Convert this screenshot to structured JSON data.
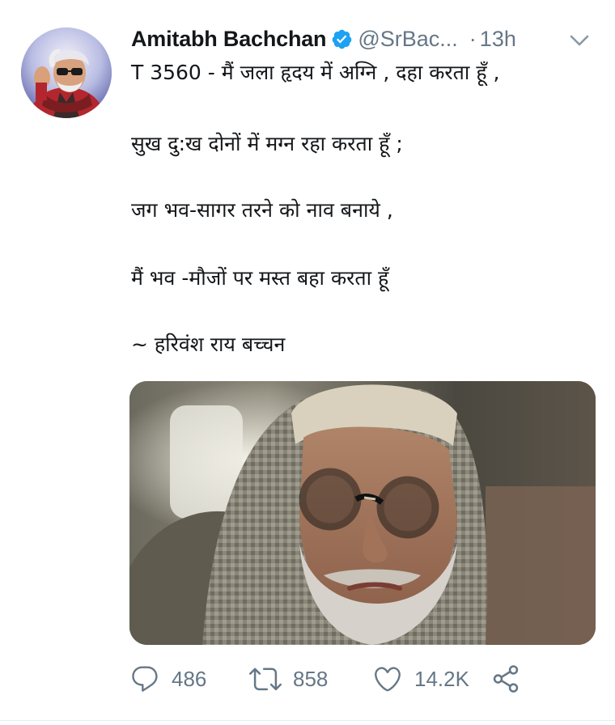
{
  "author": {
    "display_name": "Amitabh Bachchan",
    "handle": "@SrBac...",
    "verified": true,
    "time_separator": "·",
    "time": "13h",
    "avatar_icon": "user-avatar"
  },
  "tweet": {
    "lines": [
      "T 3560 - मैं  जला हृदय में अग्नि , दहा करता हूँ  ,",
      "सुख दु:ख दोनों में मग्न रहा करता हूँ  ;",
      "जग भव-सागर तरने को नाव बनाये  ,",
      "मैं भव -मौजों पर मस्त बहा करता हूँ",
      "~ हरिवंश राय बच्चन"
    ]
  },
  "actions": {
    "reply": {
      "icon": "reply-icon",
      "count": "486"
    },
    "retweet": {
      "icon": "retweet-icon",
      "count": "858"
    },
    "like": {
      "icon": "heart-icon",
      "count": "14.2K"
    },
    "share": {
      "icon": "share-icon"
    }
  },
  "colors": {
    "text": "#14171a",
    "secondary": "#657786",
    "verified": "#1da1f2"
  }
}
